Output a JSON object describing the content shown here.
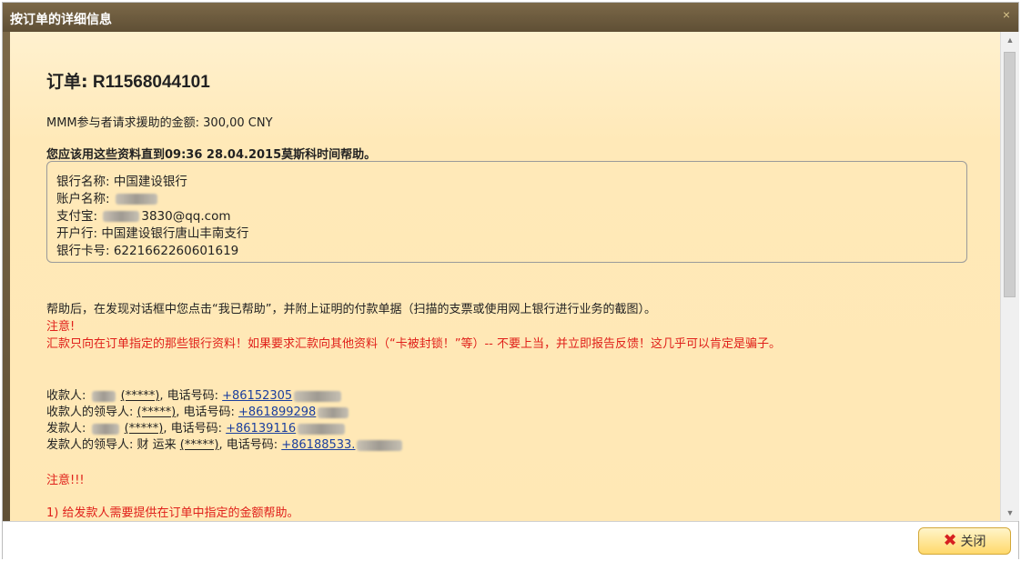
{
  "dialog": {
    "title": "按订单的详细信息",
    "close_glyph": "×"
  },
  "order": {
    "label": "订单:",
    "number": "R11568044101"
  },
  "amount_text": "MMM参与者请求援助的金额: 300,00 CNY",
  "deadline_text": "您应该用这些资料直到09:36 28.04.2015莫斯科时间帮助。",
  "bank_info": {
    "bank_name": "银行名称: 中国建设银行",
    "account_name_label": "账户名称:",
    "alipay_label": "支付宝:",
    "alipay_suffix": "3830@qq.com",
    "branch": "开户行: 中国建设银行唐山丰南支行",
    "card_number": "银行卡号: 6221662260601619"
  },
  "instructions": {
    "after_help": "帮助后，在发现对话框中您点击“我已帮助”，并附上证明的付款单据（扫描的支票或使用网上银行进行业务的截图）。",
    "attention": "注意!",
    "warning": "汇款只向在订单指定的那些银行资料！如果要求汇款向其他资料（“卡被封锁！”等）-- 不要上当，并立即报告反馈！这几乎可以肯定是骗子。"
  },
  "contacts": [
    {
      "label": "收款人:",
      "masked": "(*****)",
      "phone_label": ", 电话号码:",
      "phone": "+86152305"
    },
    {
      "label": "收款人的领导人:",
      "masked": "(*****)",
      "phone_label": ", 电话号码:",
      "phone": "+861899298"
    },
    {
      "label": "发款人:",
      "masked": "(*****)",
      "phone_label": ", 电话号码:",
      "phone": "+86139116"
    },
    {
      "label": "发款人的领导人: 财 运来",
      "masked": "(*****)",
      "phone_label": ", 电话号码:",
      "phone": "+86188533."
    }
  ],
  "notice": {
    "heading": "注意!!!",
    "item1": "1) 给发款人需要提供在订单中指定的金额帮助。"
  },
  "footer": {
    "close_label": "关闭"
  }
}
